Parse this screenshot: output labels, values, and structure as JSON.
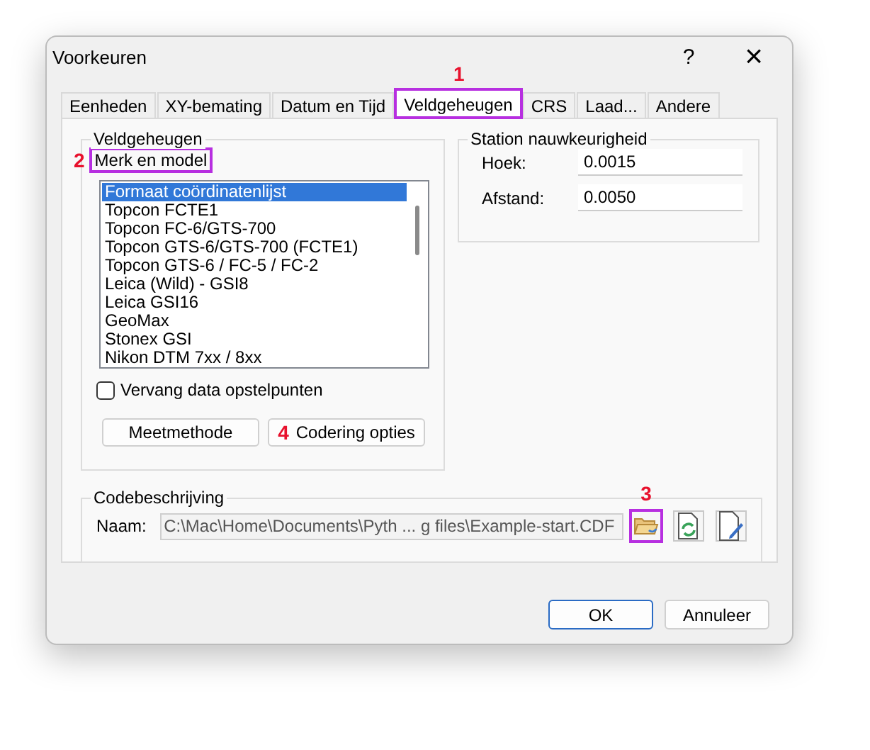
{
  "window": {
    "title": "Voorkeuren",
    "help": "?",
    "close": "×"
  },
  "tabs": [
    {
      "label": "Eenheden",
      "selected": false,
      "highlighted": false
    },
    {
      "label": "XY-bemating",
      "selected": false,
      "highlighted": false
    },
    {
      "label": "Datum en Tijd",
      "selected": false,
      "highlighted": false
    },
    {
      "label": "Veldgeheugen",
      "selected": true,
      "highlighted": true,
      "marker": "1"
    },
    {
      "label": "CRS",
      "selected": false,
      "highlighted": false
    },
    {
      "label": "Laad...",
      "selected": false,
      "highlighted": false
    },
    {
      "label": "Andere",
      "selected": false,
      "highlighted": false
    }
  ],
  "field_memory": {
    "title": "Veldgeheugen",
    "list_label": {
      "text": "Merk en model",
      "highlighted": true,
      "marker": "2"
    },
    "items": [
      {
        "label": "Formaat coördinatenlijst",
        "selected": true
      },
      {
        "label": "Topcon FCTE1",
        "selected": false
      },
      {
        "label": "Topcon FC-6/GTS-700",
        "selected": false
      },
      {
        "label": "Topcon GTS-6/GTS-700 (FCTE1)",
        "selected": false
      },
      {
        "label": "Topcon GTS-6 / FC-5 / FC-2",
        "selected": false
      },
      {
        "label": "Leica (Wild) - GSI8",
        "selected": false
      },
      {
        "label": "Leica GSI16",
        "selected": false
      },
      {
        "label": "GeoMax",
        "selected": false
      },
      {
        "label": "Stonex GSI",
        "selected": false
      },
      {
        "label": "Nikon DTM 7xx / 8xx",
        "selected": false
      }
    ],
    "checkbox": {
      "label": "Vervang data opstelpunten",
      "checked": false
    },
    "buttons": [
      {
        "label": "Meetmethode"
      },
      {
        "label": "Codering opties",
        "marker": "4"
      }
    ]
  },
  "station_accuracy": {
    "title": "Station nauwkeurigheid",
    "fields": [
      {
        "label": "Hoek:",
        "value": "0.0015"
      },
      {
        "label": "Afstand:",
        "value": "0.0050"
      }
    ]
  },
  "code_description": {
    "title": "Codebeschrijving",
    "label": "Naam:",
    "value": "C:\\Mac\\Home\\Documents\\Pyth ... g files\\Example-start.CDF",
    "icon_buttons": [
      {
        "kind": "open",
        "highlighted": true,
        "marker": "3"
      },
      {
        "kind": "reload",
        "highlighted": false
      },
      {
        "kind": "edit",
        "highlighted": false
      }
    ]
  },
  "buttons": [
    {
      "label": "OK",
      "default": true
    },
    {
      "label": "Annuleer",
      "default": false
    }
  ]
}
